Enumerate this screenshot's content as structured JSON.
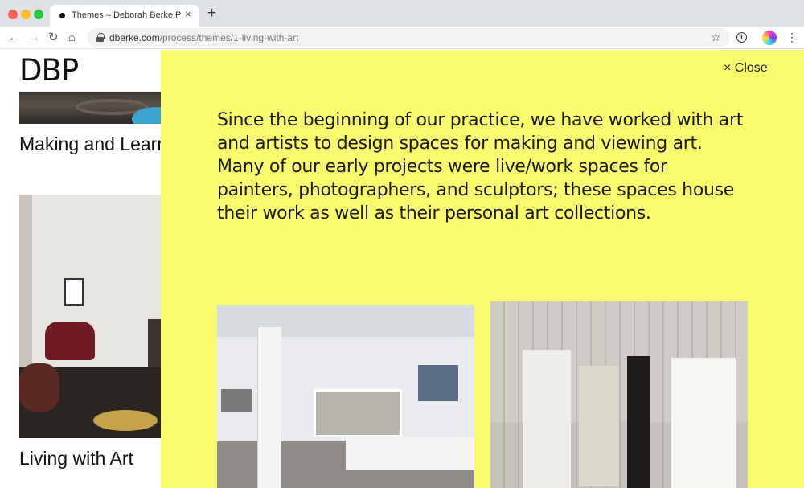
{
  "browser": {
    "tab_title": "Themes – Deborah Berke Partners",
    "tab_close": "×",
    "new_tab": "+",
    "url_host": "dberke.com",
    "url_path": "/process/themes/1-living-with-art",
    "icons": [
      "back-icon",
      "forward-icon",
      "reload-icon",
      "home-icon",
      "lock-icon",
      "star-icon",
      "info-icon",
      "profile-avatar",
      "menu-icon"
    ]
  },
  "page": {
    "logo": "DBP",
    "sections": [
      {
        "title": "Making and Learning"
      },
      {
        "title": "Living with Art"
      }
    ]
  },
  "overlay": {
    "close_label": "× Close",
    "intro": "Since the beginning of our practice, we have worked with art and artists to design spaces for making and viewing art. Many of our early projects were live/work spaces for painters, photographers, and sculptors; these spaces house their work as well as their personal art collections.",
    "background_color": "#fafa6e"
  }
}
